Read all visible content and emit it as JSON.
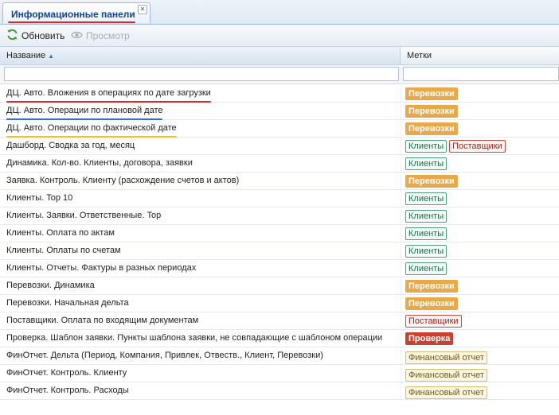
{
  "tab": {
    "label": "Информационные панели"
  },
  "toolbar": {
    "refresh_label": "Обновить",
    "view_label": "Просмотр"
  },
  "grid": {
    "columns": {
      "name": "Название",
      "tags": "Метки"
    },
    "rows": [
      {
        "name": "ДЦ. Авто. Вложения в операциях по дате загрузки",
        "tags": [
          "Перевозки"
        ],
        "highlight": "#e2232a"
      },
      {
        "name": "ДЦ. Авто. Операции по плановой дате",
        "tags": [
          "Перевозки"
        ],
        "highlight": "#2f6fd1"
      },
      {
        "name": "ДЦ. Авто. Операции по фактической дате",
        "tags": [
          "Перевозки"
        ],
        "highlight": "#f2c21a"
      },
      {
        "name": "Дашборд. Сводка за год, месяц",
        "tags": [
          "Клиенты",
          "Поставщики"
        ]
      },
      {
        "name": "Динамика. Кол-во. Клиенты, договора, заявки",
        "tags": [
          "Клиенты"
        ]
      },
      {
        "name": "Заявка. Контроль. Клиенту (расхождение счетов и актов)",
        "tags": [
          "Перевозки"
        ]
      },
      {
        "name": "Клиенты. Top 10",
        "tags": [
          "Клиенты"
        ]
      },
      {
        "name": "Клиенты. Заявки. Ответственные. Top",
        "tags": [
          "Клиенты"
        ]
      },
      {
        "name": "Клиенты. Оплата по актам",
        "tags": [
          "Клиенты"
        ]
      },
      {
        "name": "Клиенты. Оплаты по счетам",
        "tags": [
          "Клиенты"
        ]
      },
      {
        "name": "Клиенты. Отчеты. Фактуры в разных периодах",
        "tags": [
          "Клиенты"
        ]
      },
      {
        "name": "Перевозки. Динамика",
        "tags": [
          "Перевозки"
        ]
      },
      {
        "name": "Перевозки. Начальная дельта",
        "tags": [
          "Перевозки"
        ]
      },
      {
        "name": "Поставщики. Оплата по входящим документам",
        "tags": [
          "Поставщики"
        ]
      },
      {
        "name": "Проверка. Шаблон заявки. Пункты шаблона заявки, не совпадающие с шаблоном операции",
        "tags": [
          "Проверка"
        ]
      },
      {
        "name": "ФинОтчет. Дельта (Период, Компания, Привлек, Отвеств., Клиент, Перевозки)",
        "tags": [
          "Финансовый отчет"
        ]
      },
      {
        "name": "ФинОтчет. Контроль. Клиенту",
        "tags": [
          "Финансовый отчет"
        ]
      },
      {
        "name": "ФинОтчет. Контроль. Расходы",
        "tags": [
          "Финансовый отчет"
        ]
      }
    ]
  },
  "tag_styles": {
    "Перевозки": "perevozki",
    "Клиенты": "klienty",
    "Поставщики": "postavshiki",
    "Проверка": "proverka",
    "Финансовый отчет": "fin"
  },
  "colors": {
    "accent": "#15428b",
    "tab_underline": "#e2232a"
  }
}
